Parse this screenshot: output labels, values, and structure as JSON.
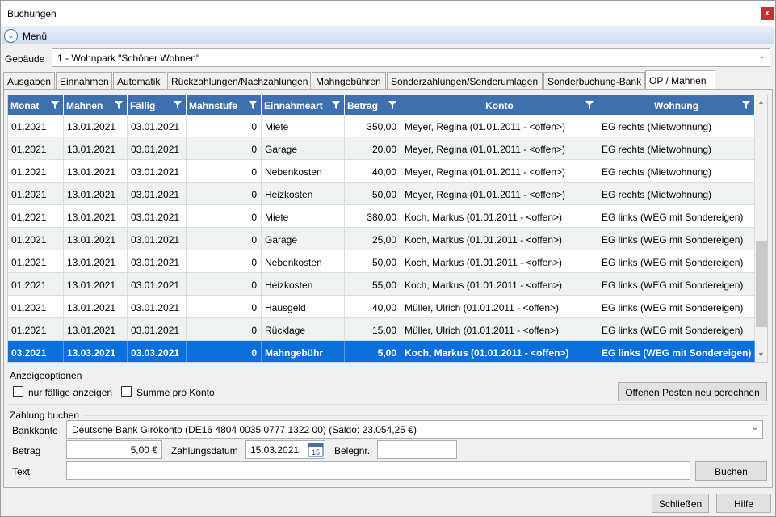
{
  "window": {
    "title": "Buchungen",
    "close_label": "x"
  },
  "menu": {
    "label": "Menü"
  },
  "building": {
    "label": "Gebäude",
    "value": "1 - Wohnpark \"Schöner Wohnen\""
  },
  "tabs": [
    {
      "label": "Ausgaben"
    },
    {
      "label": "Einnahmen"
    },
    {
      "label": "Automatik"
    },
    {
      "label": "Rückzahlungen/Nachzahlungen"
    },
    {
      "label": "Mahngebühren"
    },
    {
      "label": "Sonderzahlungen/Sonderumlagen"
    },
    {
      "label": "Sonderbuchung-Bank"
    },
    {
      "label": "OP / Mahnen"
    }
  ],
  "grid": {
    "columns": [
      "Monat",
      "Mahnen",
      "Fällig",
      "Mahnstufe",
      "Einnahmeart",
      "Betrag",
      "Konto",
      "Wohnung"
    ],
    "rows": [
      [
        "01.2021",
        "13.01.2021",
        "03.01.2021",
        "0",
        "Miete",
        "350,00",
        "Meyer, Regina (01.01.2011 - <offen>)",
        "EG rechts (Mietwohnung)"
      ],
      [
        "01.2021",
        "13.01.2021",
        "03.01.2021",
        "0",
        "Garage",
        "20,00",
        "Meyer, Regina (01.01.2011 - <offen>)",
        "EG rechts (Mietwohnung)"
      ],
      [
        "01.2021",
        "13.01.2021",
        "03.01.2021",
        "0",
        "Nebenkosten",
        "40,00",
        "Meyer, Regina (01.01.2011 - <offen>)",
        "EG rechts (Mietwohnung)"
      ],
      [
        "01.2021",
        "13.01.2021",
        "03.01.2021",
        "0",
        "Heizkosten",
        "50,00",
        "Meyer, Regina (01.01.2011 - <offen>)",
        "EG rechts (Mietwohnung)"
      ],
      [
        "01.2021",
        "13.01.2021",
        "03.01.2021",
        "0",
        "Miete",
        "380,00",
        "Koch, Markus (01.01.2011 - <offen>)",
        "EG links (WEG mit Sondereigen)"
      ],
      [
        "01.2021",
        "13.01.2021",
        "03.01.2021",
        "0",
        "Garage",
        "25,00",
        "Koch, Markus (01.01.2011 - <offen>)",
        "EG links (WEG mit Sondereigen)"
      ],
      [
        "01.2021",
        "13.01.2021",
        "03.01.2021",
        "0",
        "Nebenkosten",
        "50,00",
        "Koch, Markus (01.01.2011 - <offen>)",
        "EG links (WEG mit Sondereigen)"
      ],
      [
        "01.2021",
        "13.01.2021",
        "03.01.2021",
        "0",
        "Heizkosten",
        "55,00",
        "Koch, Markus (01.01.2011 - <offen>)",
        "EG links (WEG mit Sondereigen)"
      ],
      [
        "01.2021",
        "13.01.2021",
        "03.01.2021",
        "0",
        "Hausgeld",
        "40,00",
        "Müller, Ulrich (01.01.2011 - <offen>)",
        "EG links (WEG mit Sondereigen)"
      ],
      [
        "01.2021",
        "13.01.2021",
        "03.01.2021",
        "0",
        "Rücklage",
        "15,00",
        "Müller, Ulrich (01.01.2011 - <offen>)",
        "EG links (WEG mit Sondereigen)"
      ],
      [
        "03.2021",
        "13.03.2021",
        "03.03.2021",
        "0",
        "Mahngebühr",
        "5,00",
        "Koch, Markus (01.01.2011 - <offen>)",
        "EG links (WEG mit Sondereigen)"
      ]
    ],
    "selected_row": 10
  },
  "display_options": {
    "title": "Anzeigeoptionen",
    "only_due_label": "nur fällige anzeigen",
    "sum_per_account_label": "Summe pro Konto",
    "recalc_button": "Offenen Posten neu berechnen"
  },
  "payment": {
    "title": "Zahlung buchen",
    "account_label": "Bankkonto",
    "account_value": "Deutsche Bank Girokonto (DE16 4804 0035 0777 1322 00) (Saldo: 23.054,25 €)",
    "amount_label": "Betrag",
    "amount_value": "5,00 €",
    "date_label": "Zahlungsdatum",
    "date_value": "15.03.2021",
    "calendar_day": "15",
    "receipt_label": "Belegnr.",
    "receipt_value": "",
    "text_label": "Text",
    "text_value": "",
    "book_button": "Buchen"
  },
  "footer": {
    "close_button": "Schließen",
    "help_button": "Hilfe"
  },
  "colors": {
    "header": "#3e6fae",
    "selection": "#0a6fdb",
    "alt_row": "#eef3f2"
  }
}
